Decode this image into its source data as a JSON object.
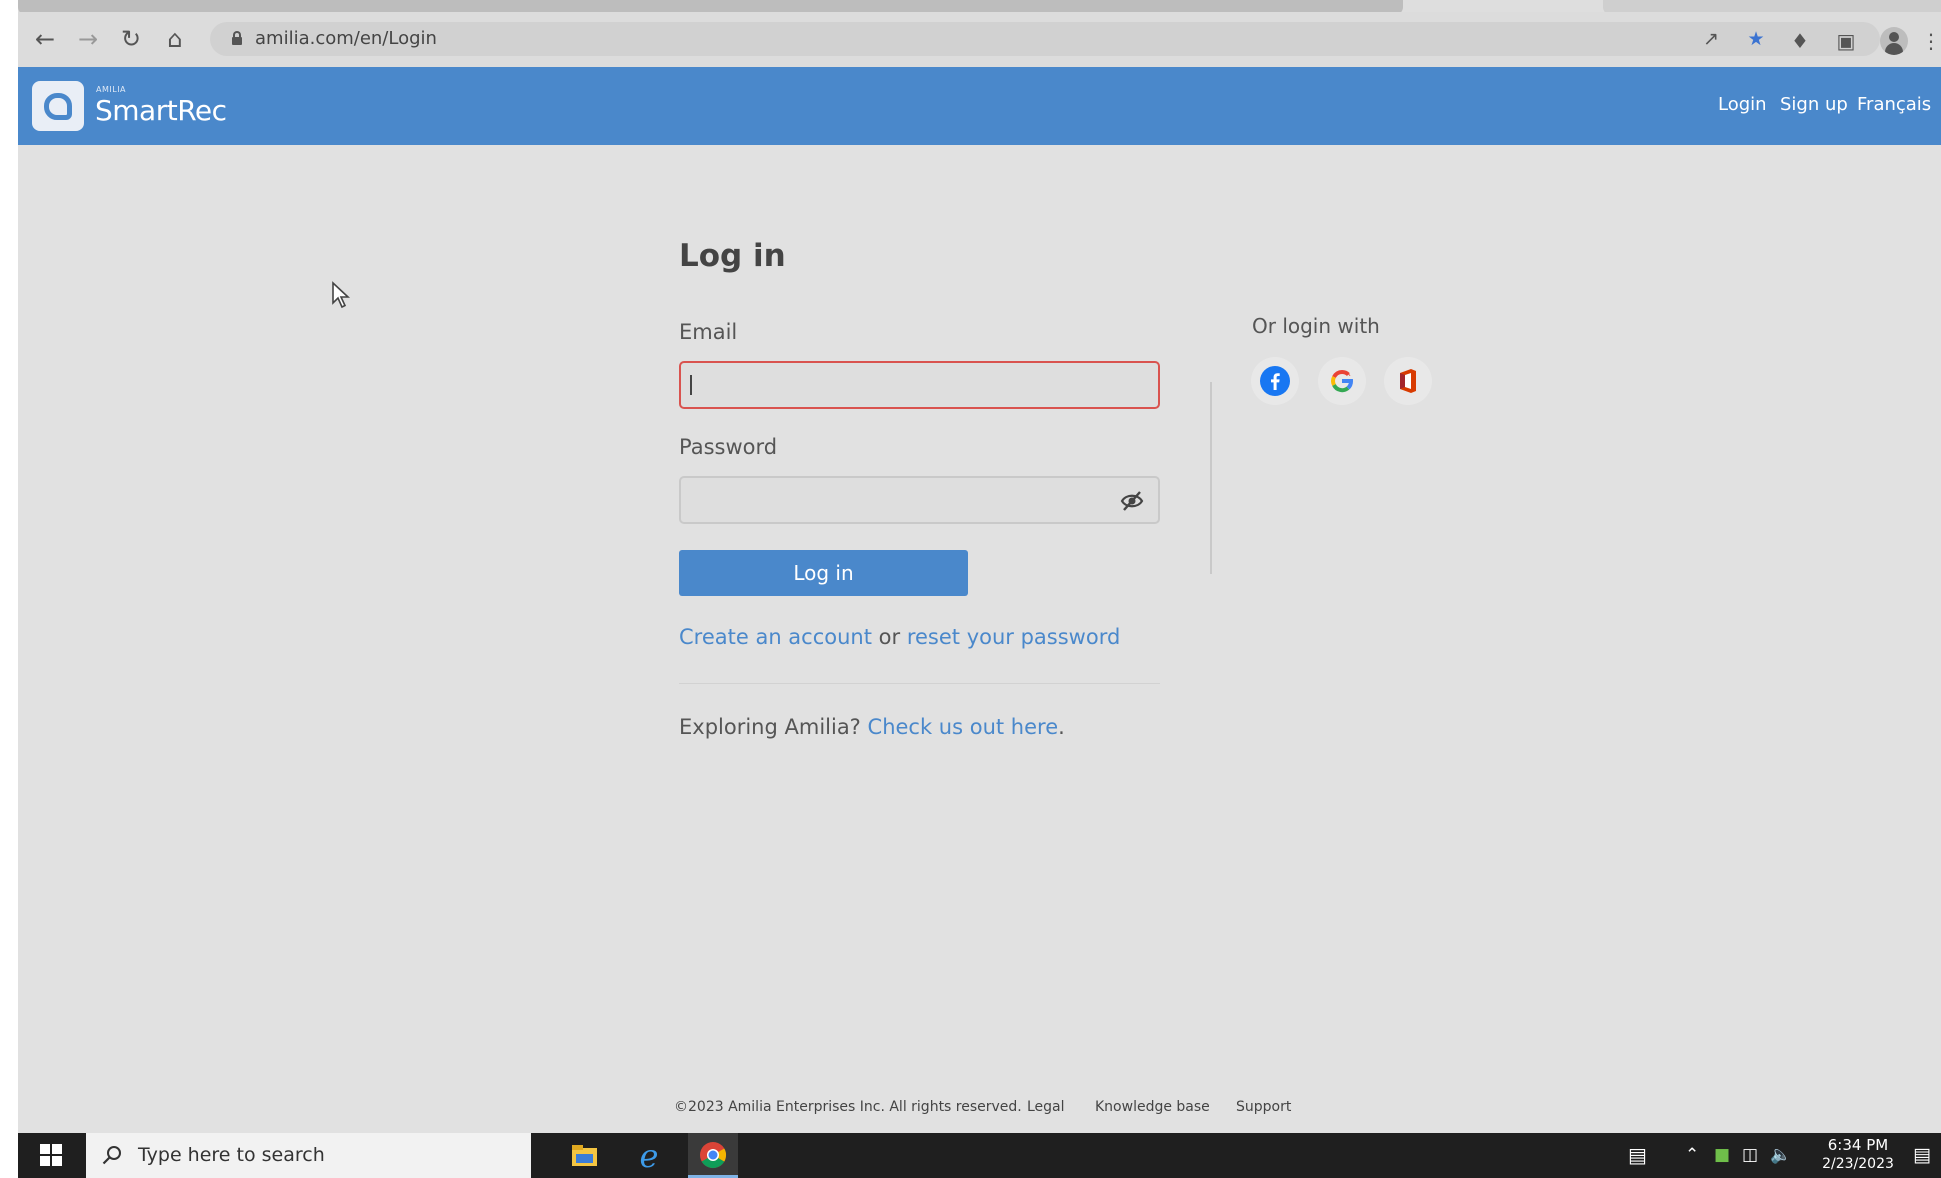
{
  "browser": {
    "url": "amilia.com/en/Login"
  },
  "header": {
    "brand_small": "AMILIA",
    "brand_name": "SmartRec",
    "links": [
      "Login",
      "Sign up",
      "Français"
    ]
  },
  "login": {
    "title": "Log in",
    "email_label": "Email",
    "email_value": "",
    "password_label": "Password",
    "password_value": "",
    "submit_label": "Log in",
    "create_account": "Create an account",
    "or_text": "or",
    "reset_password": "reset your password",
    "explore_text": "Exploring Amilia?",
    "explore_link": "Check us out here",
    "explore_period": ".",
    "or_login_with": "Or login with",
    "social_providers": [
      "facebook-icon",
      "google-icon",
      "office-icon"
    ]
  },
  "footer": {
    "copyright": "©2023 Amilia Enterprises Inc. All rights reserved.",
    "legal": "Legal",
    "knowledge_base": "Knowledge base",
    "support": "Support"
  },
  "taskbar": {
    "search_placeholder": "Type here to search",
    "time": "6:34 PM",
    "date": "2/23/2023"
  },
  "colors": {
    "brand_blue": "#4a88cb",
    "error_red": "#d9534f",
    "page_bg": "#e1e1e1"
  }
}
